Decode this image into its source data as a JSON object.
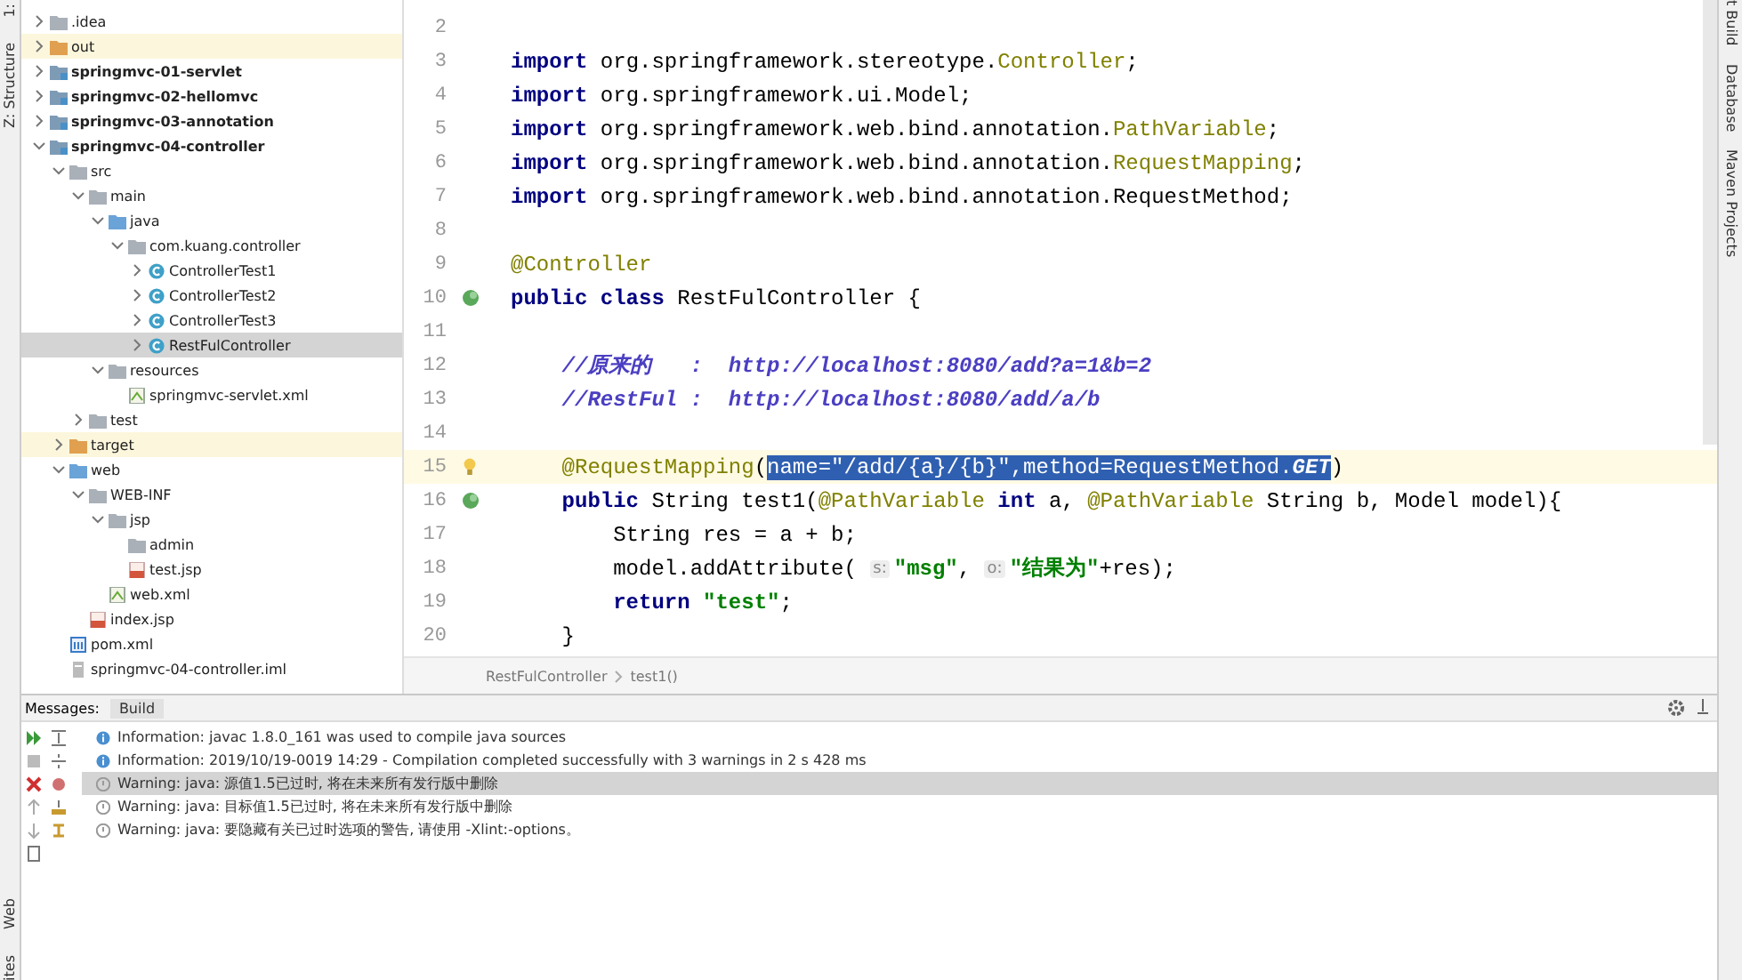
{
  "left_tool_strip": {
    "tabs": [
      "1:",
      "Z: Structure",
      "Web",
      "ites"
    ]
  },
  "right_tool_strip": {
    "tabs": [
      "t Build",
      "Database",
      "Maven Projects"
    ]
  },
  "project_tree": {
    "items": [
      {
        "label": ".idea",
        "kind": "folder",
        "expanded": false,
        "selected": false
      },
      {
        "label": "out",
        "kind": "excluded-folder",
        "expanded": false,
        "selected": false
      },
      {
        "label": "springmvc-01-servlet",
        "kind": "module",
        "expanded": false,
        "selected": false
      },
      {
        "label": "springmvc-02-hellomvc",
        "kind": "module",
        "expanded": false,
        "selected": false
      },
      {
        "label": "springmvc-03-annotation",
        "kind": "module",
        "expanded": false,
        "selected": false
      },
      {
        "label": "springmvc-04-controller",
        "kind": "module",
        "expanded": true,
        "selected": false,
        "children": [
          {
            "label": "src",
            "kind": "folder",
            "expanded": true,
            "selected": false,
            "children": [
              {
                "label": "main",
                "kind": "folder",
                "expanded": true,
                "selected": false,
                "children": [
                  {
                    "label": "java",
                    "kind": "source-folder",
                    "expanded": true,
                    "selected": false,
                    "children": [
                      {
                        "label": "com.kuang.controller",
                        "kind": "package",
                        "expanded": true,
                        "selected": false,
                        "children": [
                          {
                            "label": "ControllerTest1",
                            "kind": "class",
                            "expanded": false,
                            "selected": false
                          },
                          {
                            "label": "ControllerTest2",
                            "kind": "class",
                            "expanded": false,
                            "selected": false
                          },
                          {
                            "label": "ControllerTest3",
                            "kind": "class",
                            "expanded": false,
                            "selected": false
                          },
                          {
                            "label": "RestFulController",
                            "kind": "class",
                            "expanded": false,
                            "selected": true
                          }
                        ]
                      }
                    ]
                  },
                  {
                    "label": "resources",
                    "kind": "folder",
                    "expanded": true,
                    "selected": false,
                    "children": [
                      {
                        "label": "springmvc-servlet.xml",
                        "kind": "xml",
                        "selected": false
                      }
                    ]
                  }
                ]
              },
              {
                "label": "test",
                "kind": "folder",
                "expanded": false,
                "selected": false
              }
            ]
          },
          {
            "label": "target",
            "kind": "excluded-folder",
            "expanded": false,
            "selected": false
          },
          {
            "label": "web",
            "kind": "source-folder",
            "expanded": true,
            "selected": false,
            "children": [
              {
                "label": "WEB-INF",
                "kind": "folder",
                "expanded": true,
                "selected": false,
                "children": [
                  {
                    "label": "jsp",
                    "kind": "folder",
                    "expanded": true,
                    "selected": false,
                    "children": [
                      {
                        "label": "admin",
                        "kind": "folder",
                        "selected": false
                      },
                      {
                        "label": "test.jsp",
                        "kind": "jsp",
                        "selected": false
                      }
                    ]
                  },
                  {
                    "label": "web.xml",
                    "kind": "xml",
                    "selected": false
                  }
                ]
              },
              {
                "label": "index.jsp",
                "kind": "jsp",
                "selected": false
              }
            ]
          },
          {
            "label": "pom.xml",
            "kind": "pom",
            "selected": false
          },
          {
            "label": "springmvc-04-controller.iml",
            "kind": "iml",
            "selected": false
          }
        ]
      }
    ]
  },
  "editor": {
    "lines": [
      {
        "number": "2",
        "current": false
      },
      {
        "number": "3",
        "current": false,
        "segments": [
          {
            "text": "import",
            "kind": "keyword"
          },
          {
            "text": " org.springframework.stereotype.",
            "kind": "plain"
          },
          {
            "text": "Controller",
            "kind": "annotation"
          },
          {
            "text": ";",
            "kind": "plain"
          }
        ]
      },
      {
        "number": "4",
        "current": false,
        "segments": [
          {
            "text": "import",
            "kind": "keyword"
          },
          {
            "text": " org.springframework.ui.Model;",
            "kind": "plain"
          }
        ]
      },
      {
        "number": "5",
        "current": false,
        "segments": [
          {
            "text": "import",
            "kind": "keyword"
          },
          {
            "text": " org.springframework.web.bind.annotation.",
            "kind": "plain"
          },
          {
            "text": "PathVariable",
            "kind": "annotation"
          },
          {
            "text": ";",
            "kind": "plain"
          }
        ]
      },
      {
        "number": "6",
        "current": false,
        "segments": [
          {
            "text": "import",
            "kind": "keyword"
          },
          {
            "text": " org.springframework.web.bind.annotation.",
            "kind": "plain"
          },
          {
            "text": "RequestMapping",
            "kind": "annotation"
          },
          {
            "text": ";",
            "kind": "plain"
          }
        ]
      },
      {
        "number": "7",
        "current": false,
        "segments": [
          {
            "text": "import",
            "kind": "keyword"
          },
          {
            "text": " org.springframework.web.bind.annotation.RequestMethod;",
            "kind": "plain"
          }
        ]
      },
      {
        "number": "8",
        "current": false
      },
      {
        "number": "9",
        "current": false,
        "segments": [
          {
            "text": "@Controller",
            "kind": "annotation"
          }
        ]
      },
      {
        "number": "10",
        "current": false,
        "gutter": {
          "kind": "bean"
        },
        "segments": [
          {
            "text": "public class",
            "kind": "keyword"
          },
          {
            "text": " RestFulController {",
            "kind": "plain"
          }
        ],
        "children": [
          {
            "number": "11",
            "current": false
          },
          {
            "number": "12",
            "current": false,
            "segments": [
              {
                "text": "//原来的   :  http://localhost:8080/add?a=1&b=2",
                "kind": "comment"
              }
            ]
          },
          {
            "number": "13",
            "current": false,
            "segments": [
              {
                "text": "//RestFul :  http://localhost:8080/add/a/b",
                "kind": "comment"
              }
            ]
          },
          {
            "number": "14",
            "current": false
          },
          {
            "number": "15",
            "current": true,
            "gutter": {
              "kind": "bulb"
            },
            "segments": [
              {
                "text": "@RequestMapping",
                "kind": "annotation"
              },
              {
                "text": "(",
                "kind": "plain"
              },
              {
                "text": "name=\"/add/{a}/{b}\",method=RequestMethod.",
                "kind": "selected"
              },
              {
                "text": "GET",
                "kind": "selected-italic"
              },
              {
                "text": ")",
                "kind": "plain"
              }
            ]
          },
          {
            "number": "16",
            "current": false,
            "gutter": {
              "kind": "bean"
            },
            "segments": [
              {
                "text": "public",
                "kind": "keyword"
              },
              {
                "text": " String test1(",
                "kind": "plain"
              },
              {
                "text": "@PathVariable",
                "kind": "annotation"
              },
              {
                "text": " int",
                "kind": "keyword"
              },
              {
                "text": " a, ",
                "kind": "plain"
              },
              {
                "text": "@PathVariable",
                "kind": "annotation"
              },
              {
                "text": " String b, Model model){",
                "kind": "plain"
              }
            ],
            "children": [
              {
                "number": "17",
                "current": false,
                "segments": [
                  {
                    "text": "String res = a + b;",
                    "kind": "plain"
                  }
                ]
              },
              {
                "number": "18",
                "current": false,
                "segments": [
                  {
                    "text": "model.addAttribute( ",
                    "kind": "plain"
                  },
                  {
                    "text": "s:",
                    "kind": "hint"
                  },
                  {
                    "text": "\"msg\"",
                    "kind": "string"
                  },
                  {
                    "text": ", ",
                    "kind": "plain"
                  },
                  {
                    "text": "o:",
                    "kind": "hint"
                  },
                  {
                    "text": "\"结果为\"",
                    "kind": "string"
                  },
                  {
                    "text": "+res);",
                    "kind": "plain"
                  }
                ]
              },
              {
                "number": "19",
                "current": false,
                "segments": [
                  {
                    "text": "return",
                    "kind": "keyword"
                  },
                  {
                    "text": " \"test\"",
                    "kind": "string"
                  },
                  {
                    "text": ";",
                    "kind": "plain"
                  }
                ]
              }
            ]
          },
          {
            "number": "20",
            "current": false,
            "segments": [
              {
                "text": "}",
                "kind": "plain"
              }
            ]
          }
        ]
      }
    ],
    "breadcrumb": [
      "RestFulController",
      "test1()"
    ]
  },
  "messages": {
    "title": "Messages:",
    "tabs": [
      {
        "label": "Build",
        "selected": true
      }
    ],
    "rows": [
      {
        "kind": "info",
        "text": "Information: javac 1.8.0_161 was used to compile java sources",
        "selected": false
      },
      {
        "kind": "info",
        "text": "Information: 2019/10/19-0019 14:29 - Compilation completed successfully with 3 warnings in 2 s 428 ms",
        "selected": false
      },
      {
        "kind": "warning",
        "text": "Warning: java: 源值1.5已过时, 将在未来所有发行版中删除",
        "selected": true
      },
      {
        "kind": "warning",
        "text": "Warning: java: 目标值1.5已过时, 将在未来所有发行版中删除",
        "selected": false
      },
      {
        "kind": "warning",
        "text": "Warning: java: 要隐藏有关已过时选项的警告, 请使用 -Xlint:-options。",
        "selected": false
      }
    ]
  }
}
